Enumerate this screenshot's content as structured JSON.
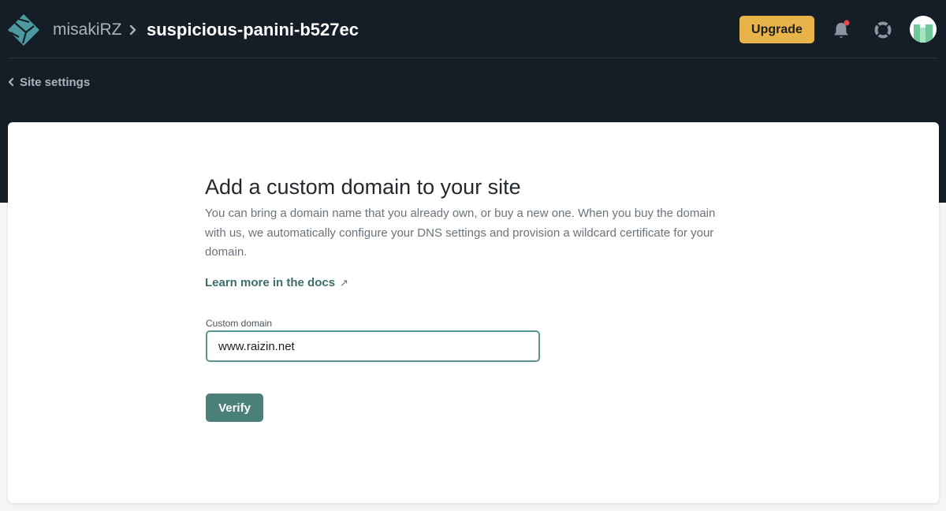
{
  "header": {
    "team_name": "misakiRZ",
    "site_name": "suspicious-panini-b527ec",
    "upgrade_label": "Upgrade",
    "icons": {
      "logo": "netlify-logo-icon",
      "bell": "notification-bell-icon",
      "help": "lifebuoy-help-icon",
      "avatar": "user-avatar"
    }
  },
  "nav": {
    "back_label": "Site settings"
  },
  "main": {
    "title": "Add a custom domain to your site",
    "description": "You can bring a domain name that you already own, or buy a new one. When you buy the domain with us, we automatically configure your DNS settings and provision a wildcard certificate for your domain.",
    "learn_more": "Learn more in the docs",
    "learn_more_arrow": "↗",
    "field_label": "Custom domain",
    "field_value": "www.raizin.net",
    "verify_label": "Verify"
  },
  "colors": {
    "header_bg": "#151d27",
    "accent_teal": "#4b7f79",
    "upgrade_yellow": "#e8b44a",
    "notification_dot": "#e5484d"
  }
}
